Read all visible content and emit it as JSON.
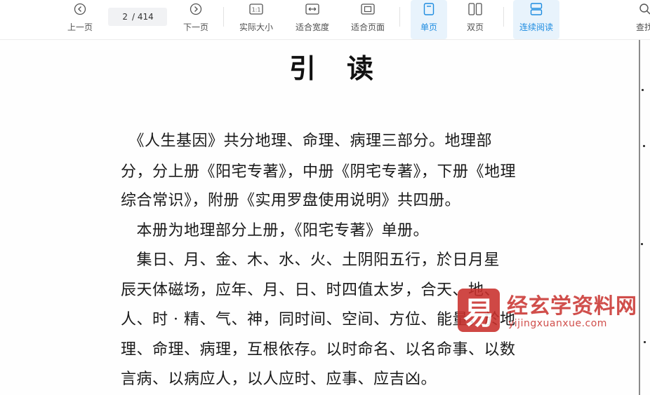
{
  "toolbar": {
    "prev_label": "上一页",
    "current_page": "2",
    "total_pages": "/ 414",
    "next_label": "下一页",
    "actual_size_label": "实际大小",
    "fit_width_label": "适合宽度",
    "fit_page_label": "适合页面",
    "single_page_label": "单页",
    "double_page_label": "双页",
    "continuous_label": "连续阅读",
    "search_label": "查找",
    "actual_size_icon_text": "1:1",
    "active_color": "#1e8ce0"
  },
  "document": {
    "title_char1": "引",
    "title_char2": "读",
    "lines": [
      "　《人生基因》共分地理、命理、病理三部分。地理部",
      "分，分上册《阳宅专著》，中册《阴宅专著》，下册《地理",
      "综合常识》，附册《实用罗盘使用说明》共四册。",
      "　本册为地理部分上册，《阳宅专著》单册。",
      "　集日、月、金、木、水、火、土阴阳五行，於日月星",
      "辰天体磁场，应年、月、日、时四值太岁，合天、地、",
      "人、时 · 精、气、神，同时间、空间、方位、能量，於地",
      "理、命理、病理，互根依存。以时命名、以名命事、以数",
      "言病、以病应人，以人应时、应事、应吉凶。"
    ]
  },
  "watermark": {
    "logo_char": "易",
    "title": "经玄学资料网",
    "url": "yijingxuanxue.com",
    "color": "#c9302c"
  }
}
